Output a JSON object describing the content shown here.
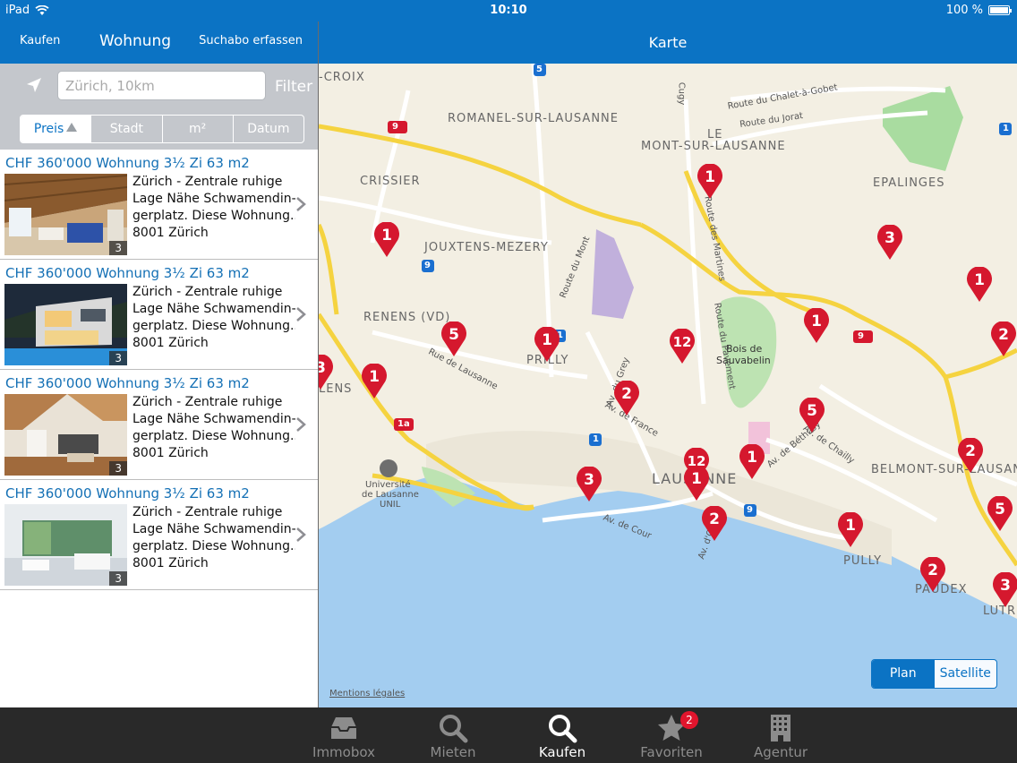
{
  "status_bar": {
    "device": "iPad",
    "time": "10:10",
    "battery": "100 %"
  },
  "left_nav": {
    "back_label": "Kaufen",
    "title": "Wohnung",
    "action_label": "Suchabo erfassen"
  },
  "right_nav": {
    "title": "Karte"
  },
  "search": {
    "placeholder": "Zürich, 10km",
    "filter_label": "Filter",
    "sort_tabs": [
      {
        "label": "Preis",
        "active": true
      },
      {
        "label": "Stadt",
        "active": false
      },
      {
        "label": "m²",
        "active": false
      },
      {
        "label": "Datum",
        "active": false
      }
    ]
  },
  "listings": [
    {
      "title": "CHF 360'000 Wohnung 3½ Zi 63 m2",
      "line1": "Zürich - Zentrale ruhige",
      "line2": "Lage Nähe Schwamendin-",
      "line3": "gerplatz. Diese Wohnung...",
      "line4": "8001 Zürich",
      "photo_count": "3",
      "photo": "attic-living-room"
    },
    {
      "title": "CHF 360'000 Wohnung 3½ Zi 63 m2",
      "line1": "Zürich - Zentrale ruhige",
      "line2": "Lage Nähe Schwamendin-",
      "line3": "gerplatz. Diese Wohnung...",
      "line4": "8001 Zürich",
      "photo_count": "3",
      "photo": "modern-house-night"
    },
    {
      "title": "CHF 360'000 Wohnung 3½ Zi 63 m2",
      "line1": "Zürich - Zentrale ruhige",
      "line2": "Lage Nähe Schwamendin-",
      "line3": "gerplatz. Diese Wohnung...",
      "line4": "8001 Zürich",
      "photo_count": "3",
      "photo": "loft-interior"
    },
    {
      "title": "CHF 360'000 Wohnung 3½ Zi 63 m2",
      "line1": "Zürich - Zentrale ruhige",
      "line2": "Lage Nähe Schwamendin-",
      "line3": "gerplatz. Diese Wohnung...",
      "line4": "8001 Zürich",
      "photo_count": "3",
      "photo": "white-living-room"
    }
  ],
  "map": {
    "labels": {
      "croix": "-CROIX",
      "romanel": "ROMANEL-SUR-LAUSANNE",
      "mont": "MONT-SUR-LAUSANNE",
      "le": "LE",
      "crissier": "CRISSIER",
      "epalinges": "EPALINGES",
      "jouxtens": "JOUXTENS-MEZERY",
      "renens": "RENENS (VD)",
      "lens": "LENS",
      "prilly": "PRILLY",
      "bois": "Bois de",
      "sauvabelin": "Sauvabelin",
      "lausanne": "LAUSANNE",
      "belmont": "BELMONT-SUR-LAUSAN",
      "pully": "PULLY",
      "paudex": "PAUDEX",
      "lutry": "LUTR",
      "unil_1": "Université",
      "unil_2": "de Lausanne",
      "unil_3": "UNIL",
      "rte_chalet": "Route du Chalet-à-Gobet",
      "rte_jorat": "Route du Jorat",
      "rte_mont": "Route du Mont",
      "rte_martines": "Route des Martines",
      "rte_pavement": "Route du Pavement",
      "rue_lausanne": "Rue de Lausanne",
      "av_grey": "Av. du Grey",
      "av_france": "Av. de France",
      "av_bethusy": "Av. de Béthusy",
      "av_chailly": "Av. de Chailly",
      "av_ouchy": "Av. d'Ouchy",
      "av_cour": "Av. de Cour",
      "cugy": "Cugy"
    },
    "road_signs": [
      "9",
      "9",
      "9",
      "9",
      "1",
      "1",
      "1a",
      "1",
      "5",
      "9"
    ],
    "pins": [
      "1",
      "1",
      "3",
      "1",
      "1",
      "5",
      "1",
      "12",
      "2",
      "1",
      "5",
      "1",
      "2",
      "12",
      "1",
      "3",
      "2",
      "1",
      "2",
      "5",
      "2",
      "3",
      "3"
    ],
    "modes": [
      {
        "label": "Plan",
        "active": true
      },
      {
        "label": "Satellite",
        "active": false
      }
    ],
    "legal": "Mentions légales"
  },
  "tab_bar": {
    "tabs": [
      {
        "label": "Immobox",
        "icon": "inbox-icon",
        "active": false
      },
      {
        "label": "Mieten",
        "icon": "search-icon",
        "active": false
      },
      {
        "label": "Kaufen",
        "icon": "search-icon",
        "active": true
      },
      {
        "label": "Favoriten",
        "icon": "star-icon",
        "active": false,
        "badge": "2"
      },
      {
        "label": "Agentur",
        "icon": "building-icon",
        "active": false
      }
    ]
  },
  "colors": {
    "brand": "#0b73c4",
    "pin": "#d5182e",
    "water": "#a3cdf0",
    "road": "#f5d340"
  }
}
